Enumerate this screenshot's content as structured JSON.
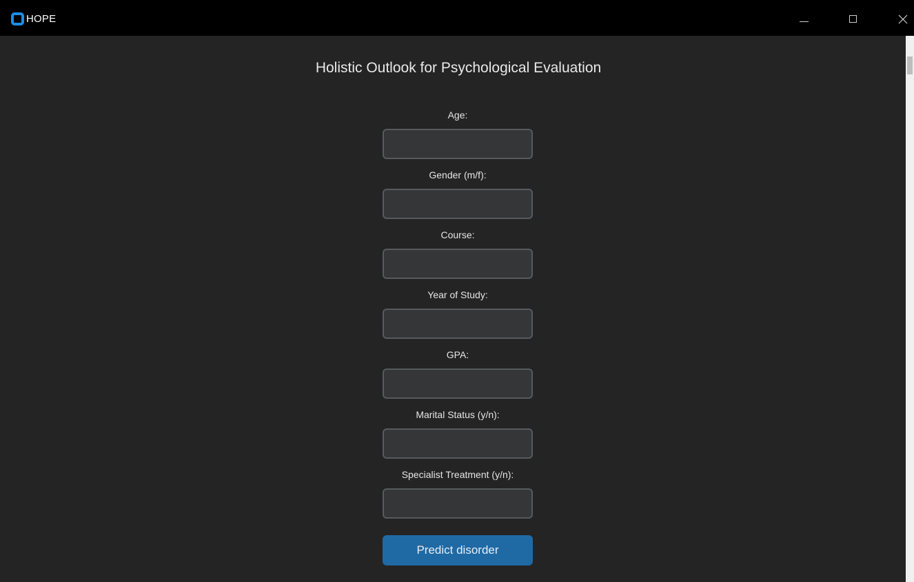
{
  "window": {
    "title": "HOPE",
    "icon": "app-logo-icon",
    "controls": [
      "minimize-icon",
      "maximize-icon",
      "close-icon"
    ]
  },
  "main": {
    "heading": "Holistic Outlook for Psychological Evaluation",
    "fields": [
      {
        "label": "Age:",
        "value": ""
      },
      {
        "label": "Gender (m/f):",
        "value": ""
      },
      {
        "label": "Course:",
        "value": ""
      },
      {
        "label": "Year of Study:",
        "value": ""
      },
      {
        "label": "GPA:",
        "value": ""
      },
      {
        "label": "Marital Status (y/n):",
        "value": ""
      },
      {
        "label": "Specialist Treatment (y/n):",
        "value": ""
      }
    ],
    "predict_label": "Predict disorder"
  },
  "colors": {
    "background": "#242424",
    "titlebar": "#000000",
    "input_bg": "#343638",
    "input_border": "#565b5e",
    "accent": "#1f6aa5",
    "logo": "#1a8ee6"
  }
}
